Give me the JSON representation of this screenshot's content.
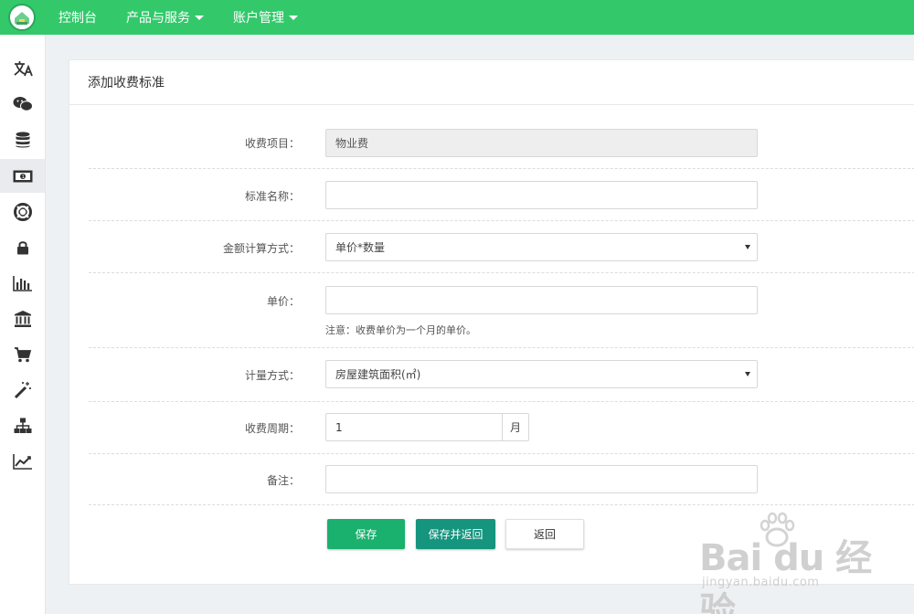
{
  "topnav": {
    "items": [
      {
        "label": "控制台"
      },
      {
        "label": "产品与服务"
      },
      {
        "label": "账户管理"
      }
    ]
  },
  "sidebar": {
    "icons": [
      "translate-icon",
      "wechat-icon",
      "database-icon",
      "money-icon",
      "lifebuoy-icon",
      "lock-icon",
      "bar-chart-icon",
      "bank-icon",
      "cart-icon",
      "magic-wand-icon",
      "sitemap-icon",
      "line-chart-icon"
    ],
    "active_index": 3
  },
  "panel": {
    "title": "添加收费标准"
  },
  "form": {
    "charge_item": {
      "label": "收费项目：",
      "value": "物业费"
    },
    "standard_name": {
      "label": "标准名称：",
      "value": "",
      "placeholder": ""
    },
    "amount_method": {
      "label": "金额计算方式：",
      "value": "单价*数量"
    },
    "unit_price": {
      "label": "单价：",
      "value": "",
      "note": "注意：收费单价为一个月的单价。"
    },
    "measure_method": {
      "label": "计量方式：",
      "value": "房屋建筑面积(㎡)"
    },
    "charge_period": {
      "label": "收费周期：",
      "value": "1",
      "unit": "月"
    },
    "remark": {
      "label": "备注：",
      "value": ""
    }
  },
  "buttons": {
    "save": "保存",
    "save_and_return": "保存并返回",
    "back": "返回"
  },
  "watermark": {
    "main": "Bai du 经验",
    "sub": "jingyan.baidu.com"
  }
}
